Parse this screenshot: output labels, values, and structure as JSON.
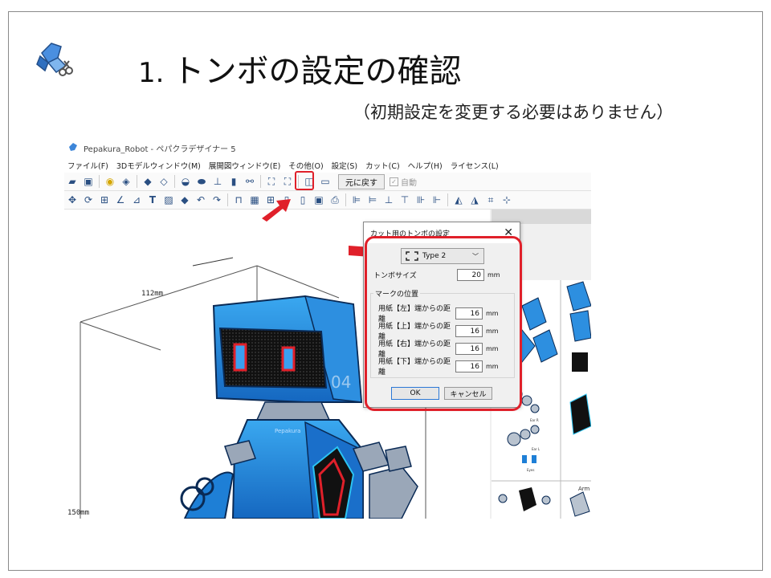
{
  "slide": {
    "number": "1.",
    "title": "トンボの設定の確認",
    "subtitle": "（初期設定を変更する必要はありません）"
  },
  "app": {
    "window_title": "Pepakura_Robot - ペパクラデザイナー 5",
    "menu": [
      "ファイル(F)",
      "3Dモデルウィンドウ(M)",
      "展開図ウィンドウ(E)",
      "その他(O)",
      "設定(S)",
      "カット(C)",
      "ヘルプ(H)",
      "ライセンス(L)"
    ],
    "toolbar": {
      "restore_label": "元に戻す",
      "auto_label": "自動"
    },
    "viewport": {
      "dim_width": "112mm",
      "dim_height": "150mm",
      "robot_label": "Pepakura",
      "robot_number": "04"
    }
  },
  "dialog": {
    "title": "カット用のトンボの設定",
    "type_value": "Type 2",
    "size_label": "トンボサイズ",
    "size_value": "20",
    "unit": "mm",
    "group_label": "マークの位置",
    "fields": [
      {
        "label": "用紙【左】端からの距離",
        "value": "16"
      },
      {
        "label": "用紙【上】端からの距離",
        "value": "16"
      },
      {
        "label": "用紙【右】端からの距離",
        "value": "16"
      },
      {
        "label": "用紙【下】端からの距離",
        "value": "16"
      }
    ],
    "ok_label": "OK",
    "cancel_label": "キャンセル"
  },
  "parts_labels": [
    "Ear R",
    "Ear L",
    "Eyes",
    "Arm"
  ],
  "colors": {
    "highlight": "#e0202a",
    "robot_blue": "#1e7fd6",
    "robot_dark": "#0a2a55"
  }
}
